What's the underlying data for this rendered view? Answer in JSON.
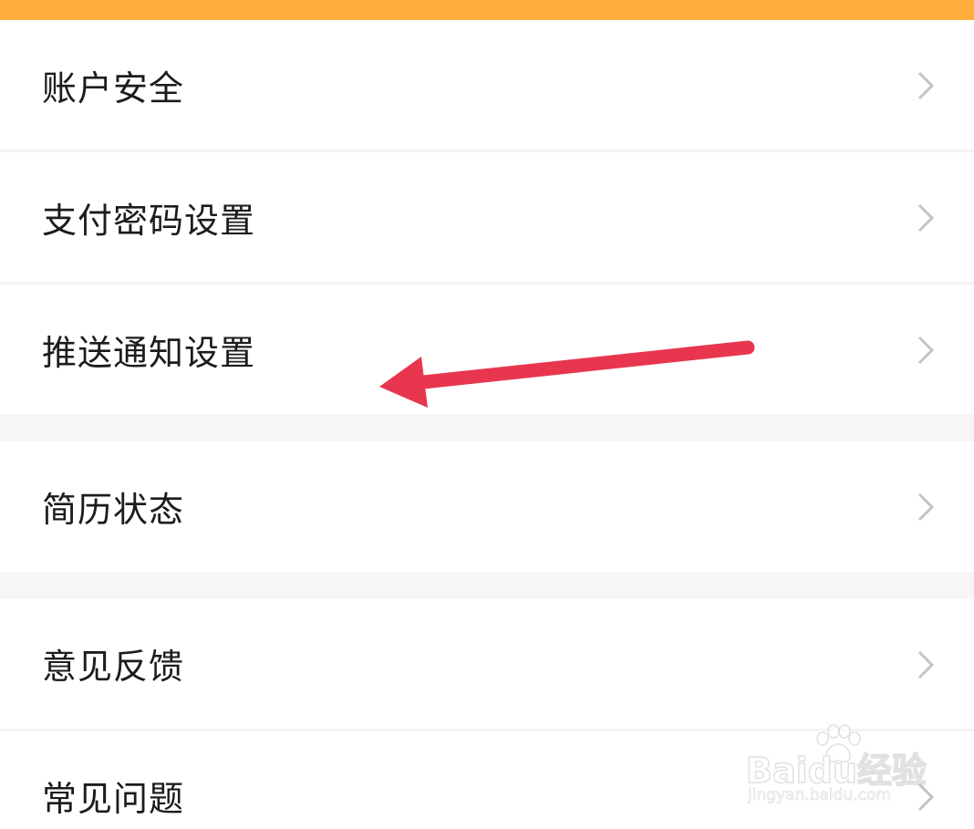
{
  "menu": {
    "items": [
      {
        "label": "账户安全"
      },
      {
        "label": "支付密码设置"
      },
      {
        "label": "推送通知设置"
      },
      {
        "label": "简历状态"
      },
      {
        "label": "意见反馈"
      },
      {
        "label": "常见问题"
      }
    ]
  },
  "annotation": {
    "color": "#e8364f"
  },
  "colors": {
    "top_bar": "#ffad3c",
    "chevron": "#c4c4c4",
    "text": "#1c1c1c"
  },
  "watermark": {
    "brand": "Baidu经验",
    "url": "jingyan.baidu.com"
  }
}
